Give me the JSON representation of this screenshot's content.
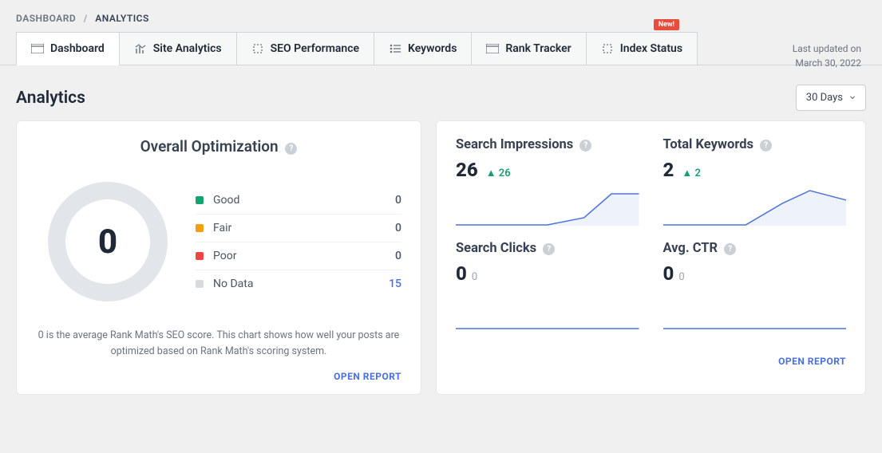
{
  "breadcrumb": {
    "root": "DASHBOARD",
    "current": "ANALYTICS"
  },
  "badge_new": "New!",
  "last_updated": {
    "label": "Last updated on",
    "date": "March 30, 2022"
  },
  "tabs": [
    {
      "label": "Dashboard"
    },
    {
      "label": "Site Analytics"
    },
    {
      "label": "SEO Performance"
    },
    {
      "label": "Keywords"
    },
    {
      "label": "Rank Tracker"
    },
    {
      "label": "Index Status"
    }
  ],
  "page_title": "Analytics",
  "range": "30 Days",
  "optimization": {
    "title": "Overall Optimization",
    "score": "0",
    "legend": [
      {
        "label": "Good",
        "color": "#15a46e",
        "value": "0"
      },
      {
        "label": "Fair",
        "color": "#f59e0b",
        "value": "0"
      },
      {
        "label": "Poor",
        "color": "#ef4444",
        "value": "0"
      },
      {
        "label": "No Data",
        "color": "#d7dbe0",
        "value": "15",
        "blue": true
      }
    ],
    "description": "0 is the average Rank Math's SEO score. This chart shows how well your posts are optimized based on Rank Math's scoring system.",
    "open_report": "OPEN REPORT"
  },
  "stats": {
    "impressions": {
      "title": "Search Impressions",
      "value": "26",
      "delta": "▲ 26"
    },
    "keywords": {
      "title": "Total Keywords",
      "value": "2",
      "delta": "▲ 2"
    },
    "clicks": {
      "title": "Search Clicks",
      "value": "0",
      "sub": "0"
    },
    "ctr": {
      "title": "Avg. CTR",
      "value": "0",
      "sub": "0"
    },
    "open_report": "OPEN REPORT"
  },
  "chart_data": [
    {
      "type": "pie",
      "title": "Overall Optimization",
      "series": [
        {
          "name": "Good",
          "value": 0
        },
        {
          "name": "Fair",
          "value": 0
        },
        {
          "name": "Poor",
          "value": 0
        },
        {
          "name": "No Data",
          "value": 15
        }
      ],
      "center_label": 0
    },
    {
      "type": "line",
      "title": "Search Impressions",
      "x": [
        0,
        1,
        2,
        3,
        4,
        5,
        6
      ],
      "values": [
        0,
        0,
        0,
        0,
        5,
        22,
        22
      ],
      "ylim": [
        0,
        26
      ]
    },
    {
      "type": "line",
      "title": "Total Keywords",
      "x": [
        0,
        1,
        2,
        3,
        4,
        5,
        6
      ],
      "values": [
        0,
        0,
        0,
        0,
        1.2,
        2,
        1.4
      ],
      "ylim": [
        0,
        2
      ]
    },
    {
      "type": "line",
      "title": "Search Clicks",
      "x": [
        0,
        1,
        2,
        3,
        4,
        5,
        6
      ],
      "values": [
        0,
        0,
        0,
        0,
        0,
        0,
        0
      ],
      "ylim": [
        0,
        1
      ]
    },
    {
      "type": "line",
      "title": "Avg. CTR",
      "x": [
        0,
        1,
        2,
        3,
        4,
        5,
        6
      ],
      "values": [
        0,
        0,
        0,
        0,
        0,
        0,
        0
      ],
      "ylim": [
        0,
        1
      ]
    }
  ]
}
